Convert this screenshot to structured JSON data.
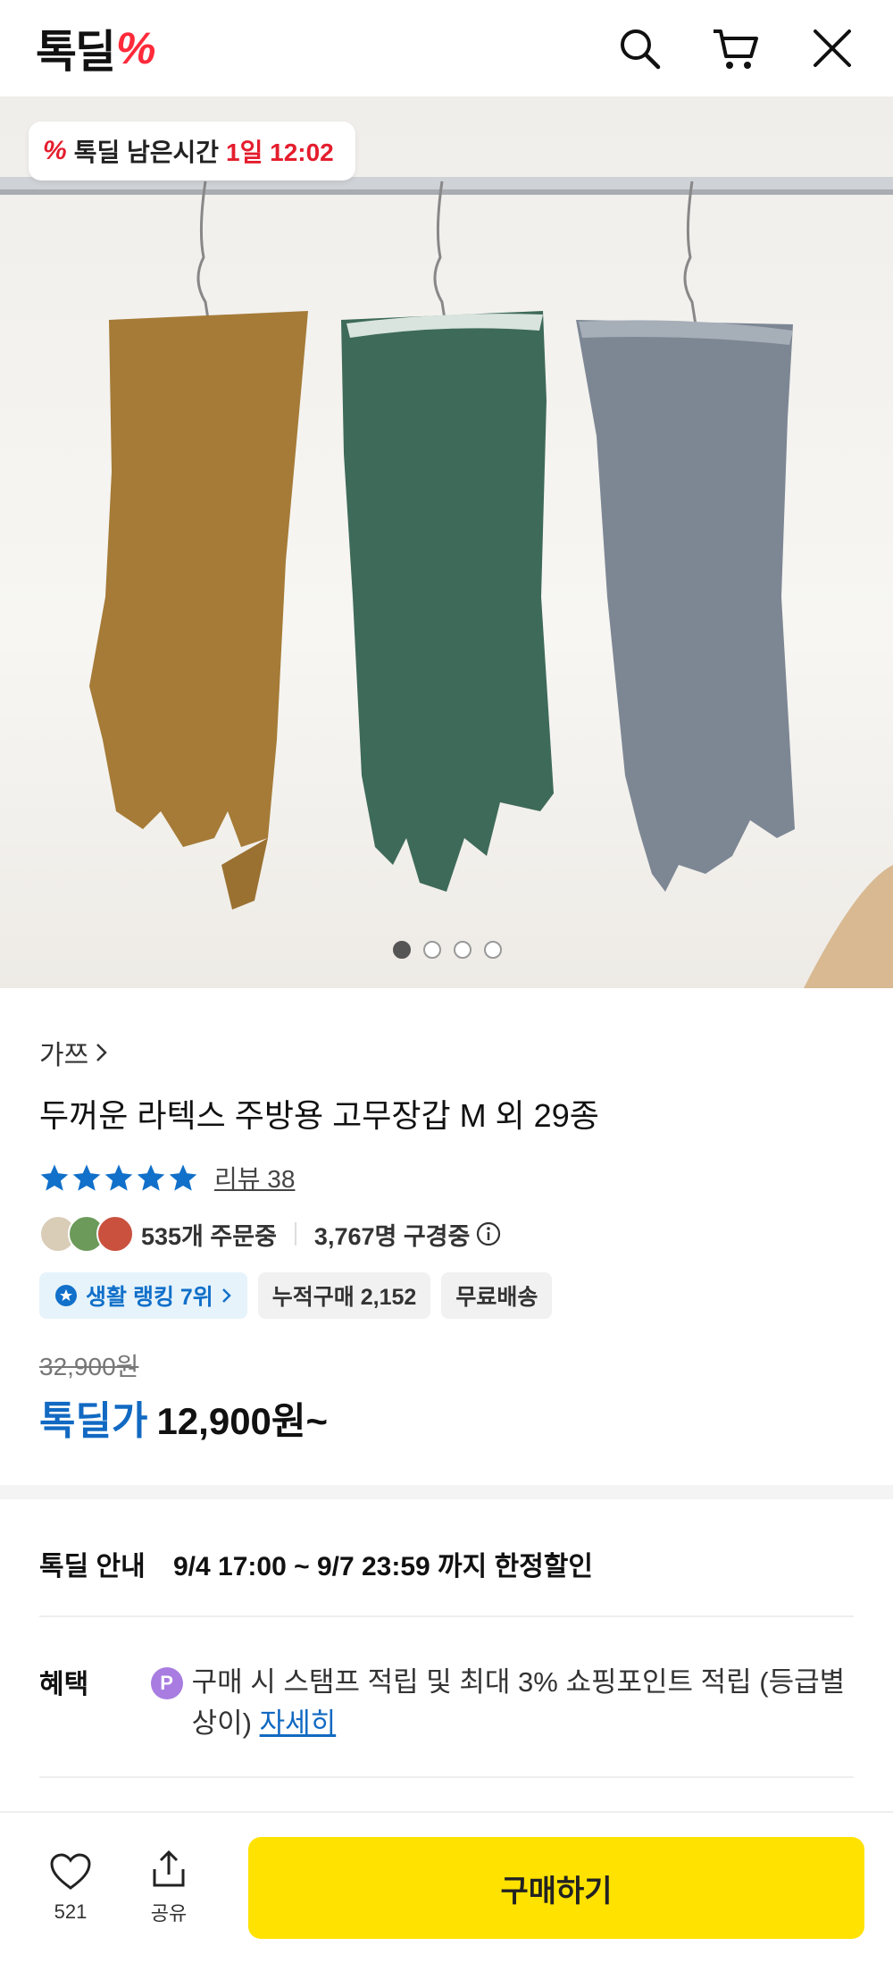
{
  "header": {
    "logo_text": "톡딜",
    "logo_mark": "%",
    "icons": [
      "search-icon",
      "cart-icon",
      "close-icon"
    ]
  },
  "hero": {
    "timer_label": "톡딜 남은시간",
    "timer_value": "1일 12:02",
    "slides": {
      "count": 4,
      "active": 1
    },
    "glove_colors": [
      "#a57b37",
      "#3e6a5a",
      "#7d8794"
    ]
  },
  "product": {
    "brand": "가쯔",
    "title": "두꺼운 라텍스 주방용 고무장갑 M 외 29종",
    "rating_stars": 5,
    "review_label": "리뷰 38",
    "orders": "535개 주문중",
    "viewers": "3,767명 구경중",
    "chips": {
      "rank": "생활 랭킹 7위",
      "cumulative": "누적구매 2,152",
      "shipping": "무료배송"
    },
    "old_price": "32,900원",
    "price_label": "톡딜가",
    "price": "12,900원~"
  },
  "details": {
    "deal_label": "톡딜 안내",
    "deal_value": "9/4 17:00 ~ 9/7 23:59 까지 한정할인",
    "benefit_label": "혜택",
    "benefit_badge": "P",
    "benefit_text": "구매 시 스탬프 적립 및 최대 3% 쇼핑포인트 적립 (등급별 상이)",
    "benefit_link": "자세히"
  },
  "bottom_bar": {
    "like_count": "521",
    "share_label": "공유",
    "buy_label": "구매하기"
  },
  "colors": {
    "accent_yellow": "#ffe200",
    "price_blue": "#1169c2",
    "deal_red": "#e41d2d",
    "star_blue": "#1170c9"
  }
}
